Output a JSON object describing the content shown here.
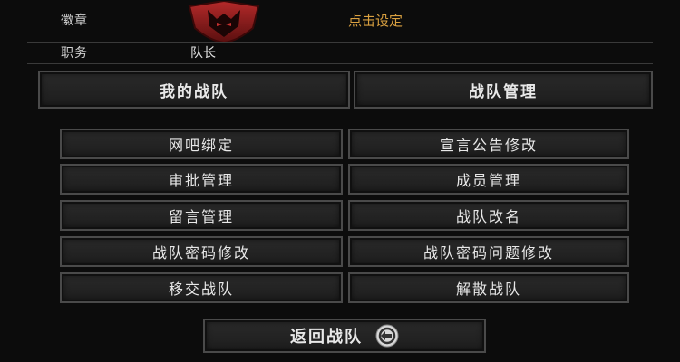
{
  "header": {
    "emblem_label": "徽章",
    "set_emblem_link": "点击设定",
    "role_label": "职务",
    "role_value": "队长"
  },
  "tabs": [
    {
      "label": "我的战队"
    },
    {
      "label": "战队管理"
    }
  ],
  "actions": [
    {
      "label": "网吧绑定"
    },
    {
      "label": "宣言公告修改"
    },
    {
      "label": "审批管理"
    },
    {
      "label": "成员管理"
    },
    {
      "label": "留言管理"
    },
    {
      "label": "战队改名"
    },
    {
      "label": "战队密码修改"
    },
    {
      "label": "战队密码问题修改"
    },
    {
      "label": "移交战队"
    },
    {
      "label": "解散战队"
    }
  ],
  "footer": {
    "back_label": "返回战队"
  },
  "colors": {
    "accent": "#d9a040",
    "emblem_red": "#8b1a1a"
  },
  "icons": {
    "emblem": "red-fox-shield-icon",
    "back": "circular-arrow-icon"
  }
}
